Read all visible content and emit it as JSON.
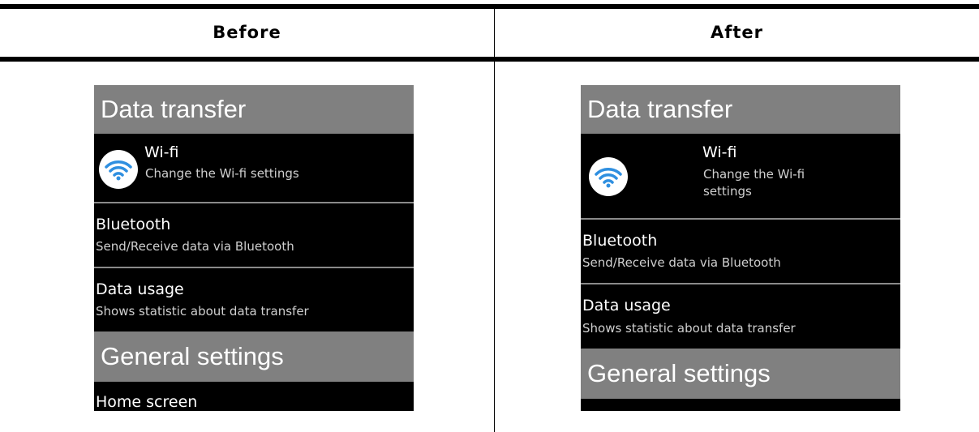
{
  "header": {
    "before": "Before",
    "after": "After"
  },
  "wifi_icon": {
    "name": "wifi-icon",
    "color": "#2f8fe0"
  },
  "before": {
    "section_data": "Data transfer",
    "wifi_title": "Wi-fi",
    "wifi_sub": "Change the Wi-fi settings",
    "bt_title": "Bluetooth",
    "bt_sub": "Send/Receive data via Bluetooth",
    "du_title": "Data usage",
    "du_sub": "Shows statistic about data transfer",
    "section_general": "General settings",
    "home_title": "Home screen"
  },
  "after": {
    "section_data": "Data transfer",
    "wifi_title": "Wi-fi",
    "wifi_sub_1": "Change the Wi-fi",
    "wifi_sub_2": "settings",
    "bt_title": "Bluetooth",
    "bt_sub": "Send/Receive data via Bluetooth",
    "du_title": "Data usage",
    "du_sub": "Shows statistic about data transfer",
    "section_general": "General settings"
  }
}
